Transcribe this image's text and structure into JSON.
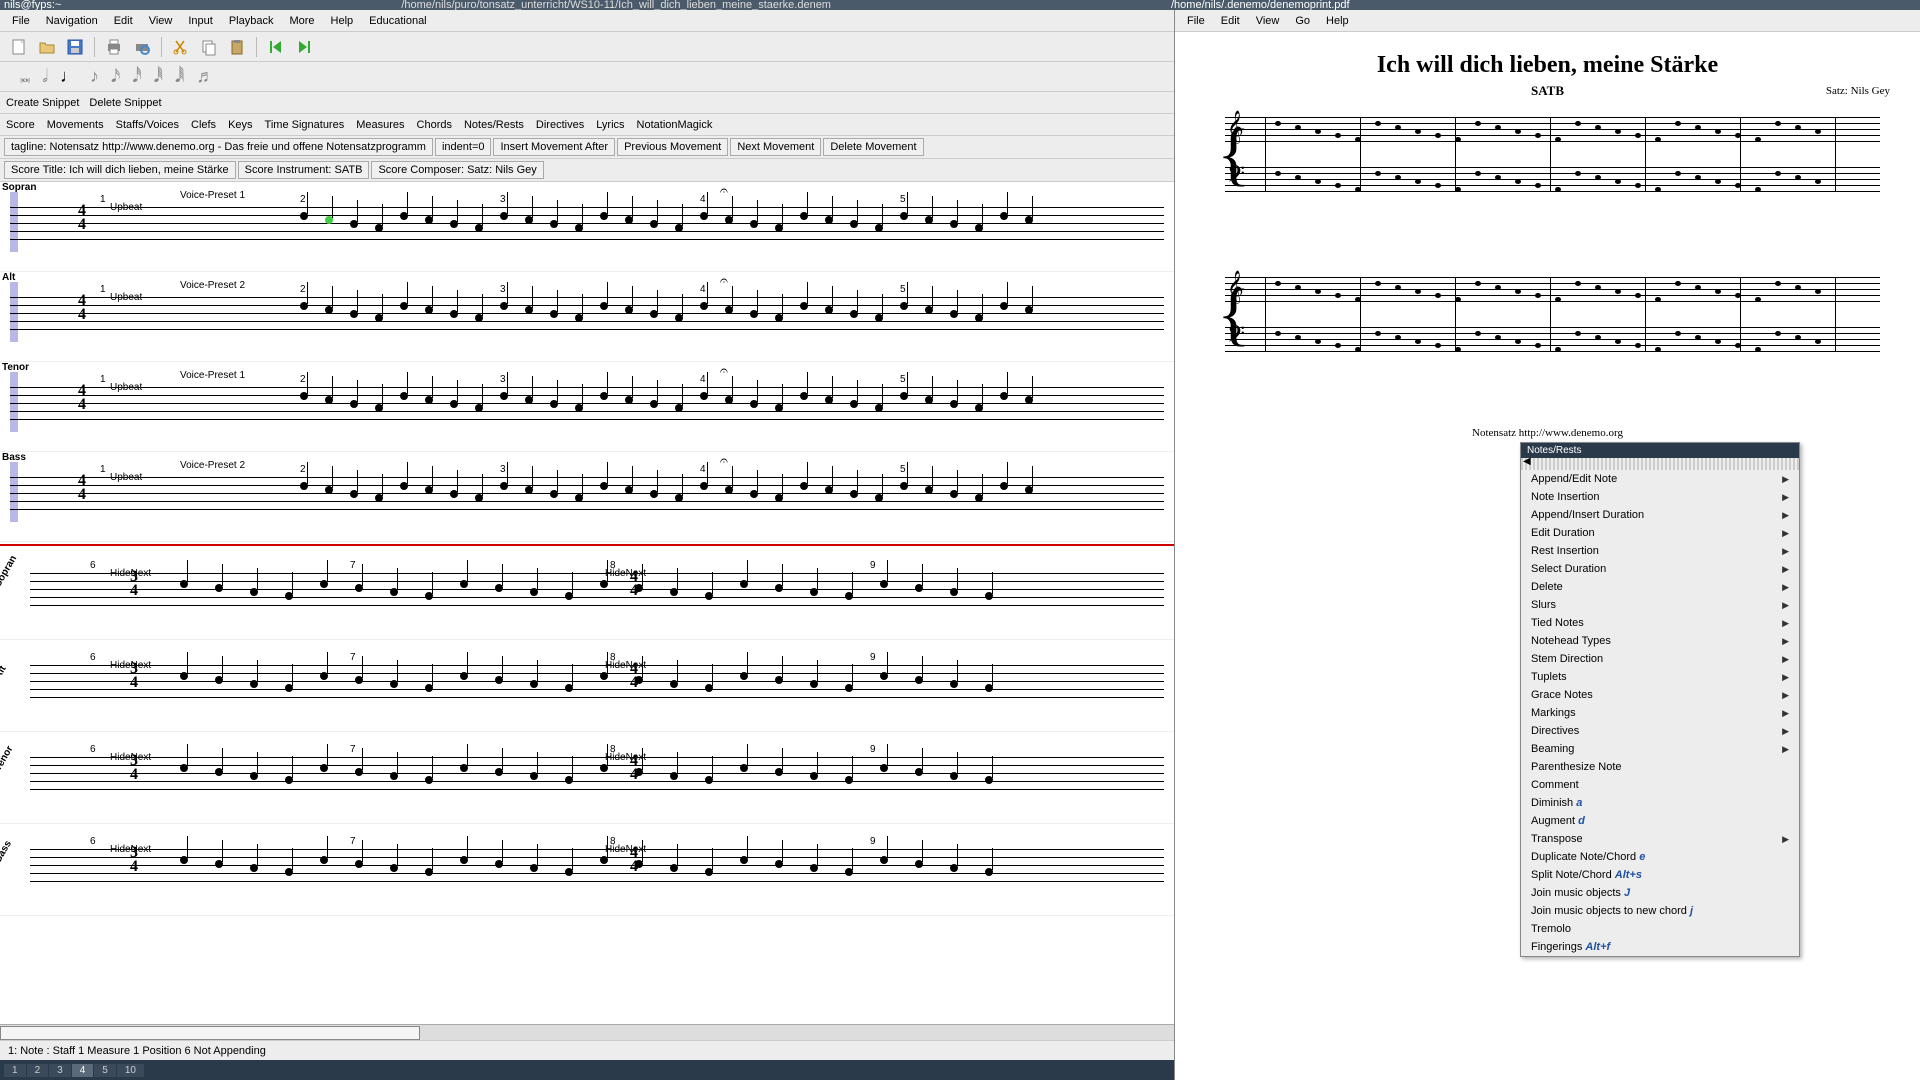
{
  "window": {
    "user_host": "nils@fyps:~",
    "path_left": "/home/nils/puro/tonsatz_unterricht/WS10-11/Ich_will_dich_lieben_meine_staerke.denem",
    "path_right": "/home/nils/.denemo/denemoprint.pdf"
  },
  "menubar_left": [
    "File",
    "Navigation",
    "Edit",
    "View",
    "Input",
    "Playback",
    "More",
    "Help",
    "Educational"
  ],
  "menubar_right": [
    "File",
    "Edit",
    "View",
    "Go",
    "Help"
  ],
  "snippet": {
    "create": "Create Snippet",
    "delete": "Delete Snippet"
  },
  "tabs": [
    "Score",
    "Movements",
    "Staffs/Voices",
    "Clefs",
    "Keys",
    "Time Signatures",
    "Measures",
    "Chords",
    "Notes/Rests",
    "Directives",
    "Lyrics",
    "NotationMagick"
  ],
  "btnrow1": [
    "tagline: Notensatz http://www.denemo.org  - Das freie und offene Notensatzprogramm",
    "indent=0",
    "Insert Movement After",
    "Previous Movement",
    "Next Movement",
    "Delete Movement"
  ],
  "btnrow2": [
    "Score Title: Ich will dich lieben, meine Stärke",
    "Score Instrument: SATB",
    "Score Composer: Satz: Nils Gey"
  ],
  "staves": [
    {
      "name": "Sopran",
      "preset": "Voice-Preset 1",
      "upbeat": "Upbeat",
      "clef": "treble",
      "measures": [
        1,
        2,
        3,
        4,
        5
      ]
    },
    {
      "name": "Alt",
      "preset": "Voice-Preset 2",
      "upbeat": "Upbeat",
      "clef": "treble",
      "measures": [
        1,
        2,
        3,
        4,
        5
      ]
    },
    {
      "name": "Tenor",
      "preset": "Voice-Preset 1",
      "upbeat": "Upbeat",
      "clef": "bass",
      "measures": [
        1,
        2,
        3,
        4,
        5
      ]
    },
    {
      "name": "Bass",
      "preset": "Voice-Preset 2",
      "upbeat": "Upbeat",
      "clef": "bass",
      "measures": [
        1,
        2,
        3,
        4,
        5
      ]
    }
  ],
  "staves_sys2": [
    {
      "name": "Sopran",
      "hide": "HideNext",
      "clef": "treble",
      "measures": [
        6,
        7,
        8,
        9
      ],
      "ts": "3/4"
    },
    {
      "name": "Alt",
      "hide": "HideNext",
      "clef": "treble",
      "measures": [
        6,
        7,
        8,
        9
      ],
      "ts": "3/4"
    },
    {
      "name": "Tenor",
      "hide": "HideNext",
      "clef": "bass",
      "measures": [
        6,
        7,
        8,
        9
      ],
      "ts": "3/4"
    },
    {
      "name": "Bass",
      "hide": "HideNext",
      "clef": "bass",
      "measures": [
        6,
        7,
        8,
        9
      ],
      "ts": "3/4"
    }
  ],
  "status": "1: Note :  Staff 1 Measure 1 Position 6 Not Appending",
  "bottom_tabs": [
    "1",
    "2",
    "3",
    "4",
    "5",
    "10"
  ],
  "bottom_active": "4",
  "pdf": {
    "title": "Ich will dich lieben, meine Stärke",
    "subtitle": "SATB",
    "composer": "Satz: Nils Gey",
    "footer": "Notensatz http://www.denemo.org"
  },
  "context": {
    "header": "Notes/Rests",
    "items": [
      {
        "label": "Append/Edit Note",
        "sub": true
      },
      {
        "label": "Note Insertion",
        "sub": true
      },
      {
        "label": "Append/Insert Duration",
        "sub": true
      },
      {
        "label": "Edit Duration",
        "sub": true
      },
      {
        "label": "Rest Insertion",
        "sub": true
      },
      {
        "label": "Select Duration",
        "sub": true
      },
      {
        "label": "Delete",
        "sub": true
      },
      {
        "label": "Slurs",
        "sub": true
      },
      {
        "label": "Tied Notes",
        "sub": true
      },
      {
        "label": "Notehead Types",
        "sub": true
      },
      {
        "label": "Stem Direction",
        "sub": true
      },
      {
        "label": "Tuplets",
        "sub": true
      },
      {
        "label": "Grace Notes",
        "sub": true
      },
      {
        "label": "Markings",
        "sub": true
      },
      {
        "label": "Directives",
        "sub": true
      },
      {
        "label": "Beaming",
        "sub": true
      },
      {
        "label": "Parenthesize Note"
      },
      {
        "label": "Comment"
      },
      {
        "label": "Diminish",
        "accel": "a"
      },
      {
        "label": "Augment",
        "accel": "d"
      },
      {
        "label": "Transpose",
        "sub": true
      },
      {
        "label": "Duplicate Note/Chord",
        "accel": "e"
      },
      {
        "label": "Split Note/Chord",
        "accel": "Alt+s"
      },
      {
        "label": "Join music objects",
        "accel": "J"
      },
      {
        "label": "Join music objects to new chord",
        "accel": "j"
      },
      {
        "label": "Tremolo"
      },
      {
        "label": "Fingerings",
        "accel": "Alt+f"
      }
    ]
  }
}
